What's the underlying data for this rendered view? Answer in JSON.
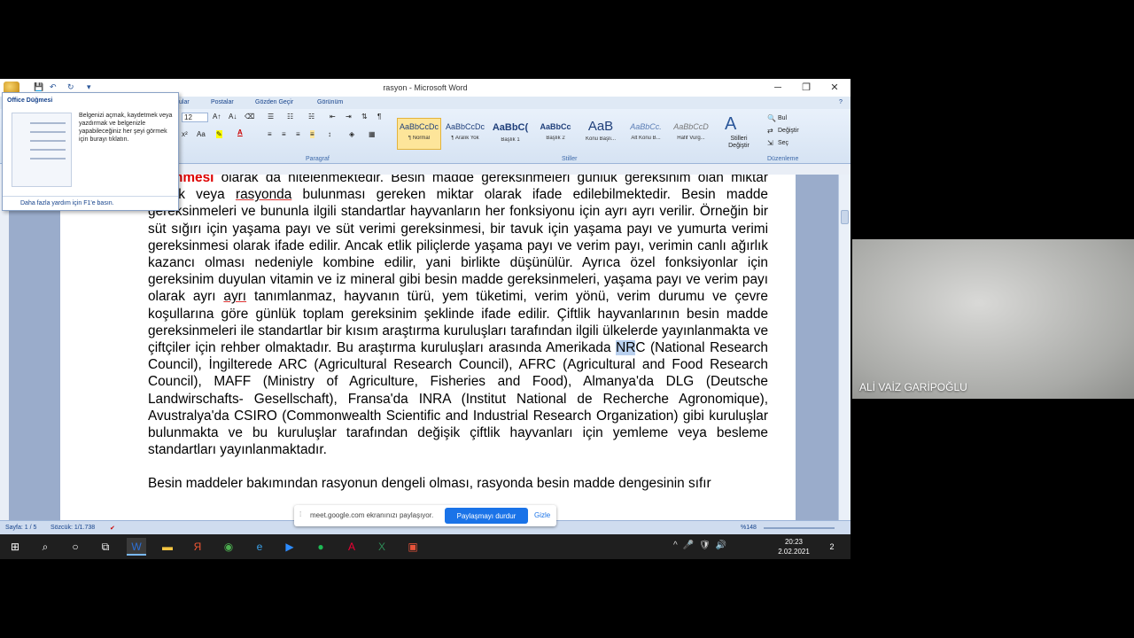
{
  "window": {
    "title": "rasyon - Microsoft Word",
    "minimize": "─",
    "restore": "❐",
    "close": "✕"
  },
  "ribbon": {
    "tabs": [
      "ular",
      "Postalar",
      "Gözden Geçir",
      "Görünüm"
    ],
    "font_size": "12",
    "groups": {
      "paragraph": "Paragraf",
      "styles": "Stiller",
      "editing": "Düzenleme"
    },
    "styles": [
      {
        "sample": "AaBbCcDc",
        "name": "¶ Normal"
      },
      {
        "sample": "AaBbCcDc",
        "name": "¶ Aralık Yok"
      },
      {
        "sample": "AaBbC(",
        "name": "Başlık 1"
      },
      {
        "sample": "AaBbCc",
        "name": "Başlık 2"
      },
      {
        "sample": "AaB",
        "name": "Konu Başlı..."
      },
      {
        "sample": "AaBbCc.",
        "name": "Alt Konu B..."
      },
      {
        "sample": "AaBbCcD",
        "name": "Hafif Vurg..."
      }
    ],
    "change_styles": "Stilleri Değiştir",
    "find": "Bul",
    "replace": "Değiştir",
    "select": "Seç"
  },
  "popup": {
    "title": "Office Düğmesi",
    "body": "Belgenizi açmak, kaydetmek veya yazdırmak ve belgenizle yapabileceğiniz her şeyi görmek için burayı tıklatın.",
    "footer": "Daha fazla yardım için F1'e basın."
  },
  "document": {
    "p1_red": "eksinmesi",
    "p1_a": " olarak da nitelenmektedir. Besin madde gereksinmeleri günlük gereksinim olan miktar olarak veya ",
    "p1_rasyonda": "rasyonda",
    "p1_b": " bulunması gereken miktar olarak ifade edilebilmektedir. Besin madde gereksinmeleri ve bununla ilgili standartlar hayvanların her fonksiyonu için ayrı ayrı verilir. Örneğin bir süt sığırı için yaşama payı ve süt verimi gereksinmesi, bir tavuk için yaşama payı ve yumurta verimi gereksinmesi olarak ifade edilir. Ancak etlik piliçlerde yaşama payı ve verim payı, verimin canlı ağırlık kazancı olması nedeniyle kombine edilir, yani birlikte düşünülür. Ayrıca özel fonksiyonlar için gereksinim duyulan vitamin ve iz mineral gibi besin madde gereksinmeleri, yaşama payı ve verim payı olarak ayrı ",
    "p1_ayri": "ayrı",
    "p1_c": " tanımlanmaz, hayvanın türü, yem tüketimi, verim yönü, verim durumu ve çevre koşullarına göre günlük toplam gereksinim şeklinde ifade edilir. Çiftlik hayvanlarının besin madde gereksinmeleri ile standartlar bir kısım araştırma kuruluşları tarafından ilgili ülkelerde yayınlanmakta ve çiftçiler için rehber olmaktadır. ",
    "p1_d": "Bu araştırma kuruluşları arasında Amerikada ",
    "p1_hl": "NR",
    "p1_e": "C (National Research Council), İngilterede ARC (Agricultural Research Council), AFRC (Agricultural and Food Research Council), MAFF (Ministry of Agriculture, Fisheries and Food), Almanya'da DLG (Deutsche Landwirschafts- Gesellschaft), Fransa'da INRA (Institut National de Recherche Agronomique), Avustralya'da CSIRO (Commonwealth Scientific and Industrial Research Organization) gibi kuruluşlar bulunmakta ve bu kuruluşlar tarafından değişik çiftlik hayvanları için yemleme veya besleme standartları yayınlanmaktadır.",
    "p2": "Besin maddeler bakımından rasyonun dengeli olması, rasyonda besin madde dengesinin sıfır"
  },
  "statusbar": {
    "page": "Sayfa: 1 / 5",
    "words": "Sözcük: 1/1.738",
    "zoom": "%148"
  },
  "share": {
    "message": "meet.google.com ekranınızı paylaşıyor.",
    "stop": "Paylaşmayı durdur",
    "hide": "Gizle"
  },
  "taskbar": {
    "time": "20:23",
    "date": "2.02.2021",
    "notifications": "2"
  },
  "participant": {
    "name": "ALİ VAİZ GARİPOĞLU"
  }
}
